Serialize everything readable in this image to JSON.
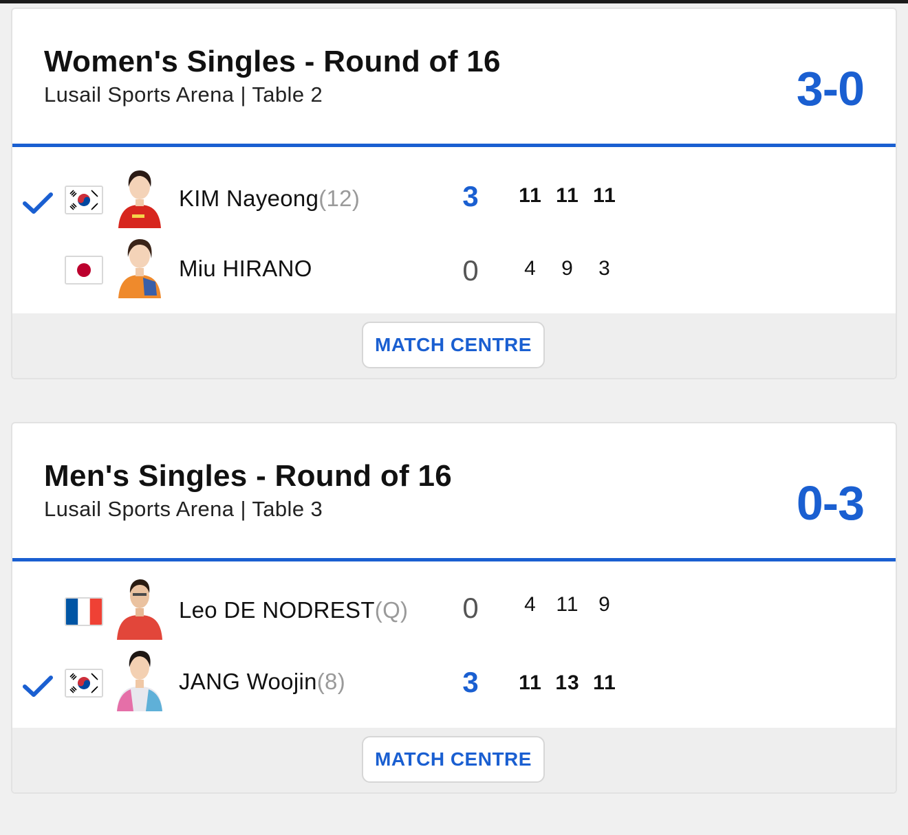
{
  "matches": [
    {
      "title": "Women's Singles - Round of 16",
      "venue": "Lusail Sports Arena | Table 2",
      "score": "3-0",
      "players": [
        {
          "name": "KIM Nayeong",
          "seed": "(12)",
          "flag": "korea-flag",
          "games": "3",
          "sets": [
            "11",
            "11",
            "11"
          ],
          "winner": true
        },
        {
          "name": "Miu HIRANO",
          "seed": "",
          "flag": "japan-flag",
          "games": "0",
          "sets": [
            "4",
            "9",
            "3"
          ],
          "winner": false
        }
      ],
      "button_label": "MATCH CENTRE"
    },
    {
      "title": "Men's Singles - Round of 16",
      "venue": "Lusail Sports Arena | Table 3",
      "score": "0-3",
      "players": [
        {
          "name": "Leo DE NODREST",
          "seed": "(Q)",
          "flag": "france-flag",
          "games": "0",
          "sets": [
            "4",
            "11",
            "9"
          ],
          "winner": false
        },
        {
          "name": "JANG Woojin",
          "seed": "(8)",
          "flag": "korea-flag",
          "games": "3",
          "sets": [
            "11",
            "13",
            "11"
          ],
          "winner": true
        }
      ],
      "button_label": "MATCH CENTRE"
    }
  ],
  "colors": {
    "accent": "#1a5fd1",
    "seed_gray": "#9a9a9a",
    "footer_bg": "#eeeeee"
  },
  "icons": {
    "winner": "checkmark-icon"
  }
}
